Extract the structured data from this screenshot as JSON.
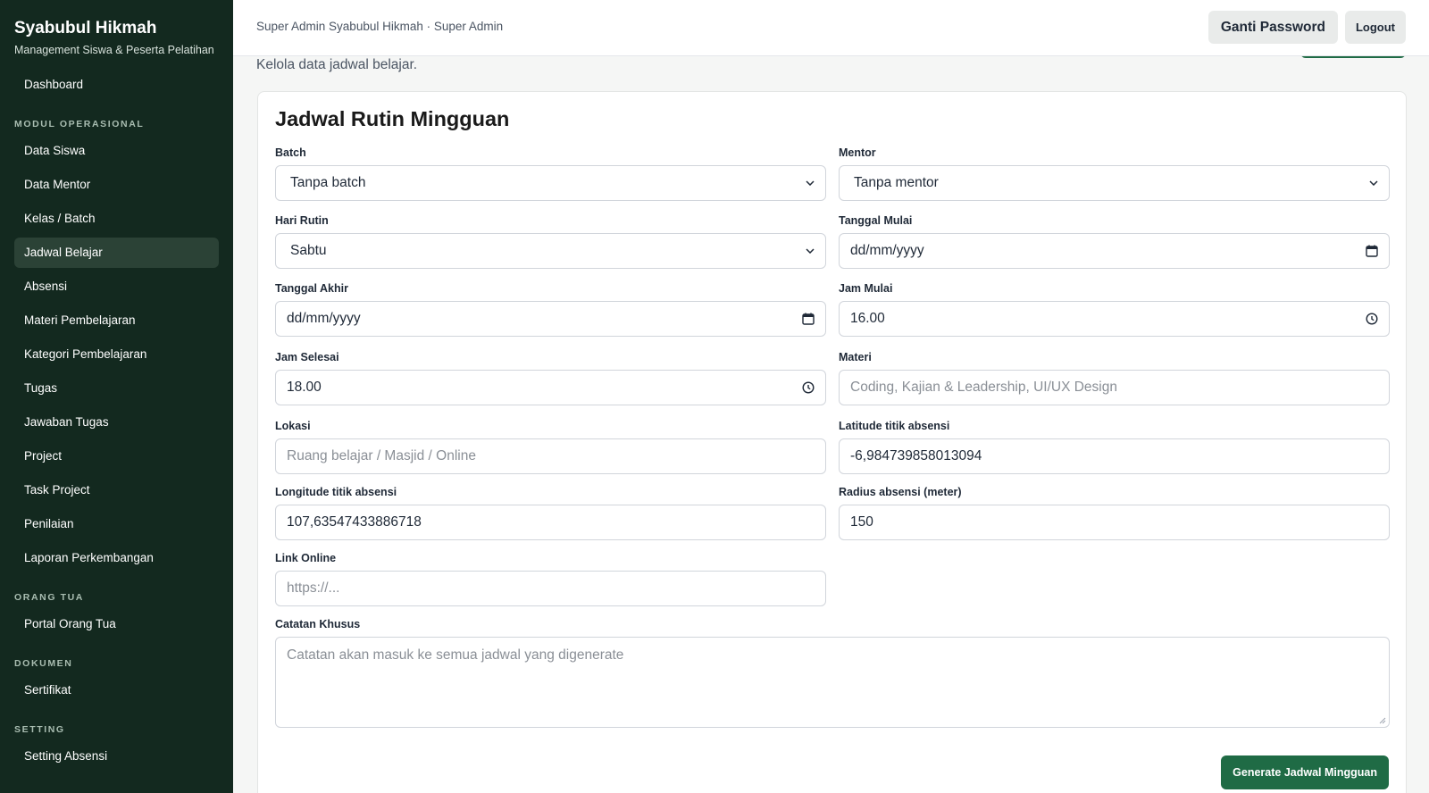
{
  "brand": {
    "title": "Syabubul Hikmah",
    "subtitle": "Management Siswa & Peserta Pelatihan"
  },
  "sidebar": {
    "top_items": [
      {
        "label": "Dashboard"
      }
    ],
    "sections": [
      {
        "title": "MODUL OPERASIONAL",
        "items": [
          {
            "label": "Data Siswa"
          },
          {
            "label": "Data Mentor"
          },
          {
            "label": "Kelas / Batch"
          },
          {
            "label": "Jadwal Belajar",
            "active": true
          },
          {
            "label": "Absensi"
          },
          {
            "label": "Materi Pembelajaran"
          },
          {
            "label": "Kategori Pembelajaran"
          },
          {
            "label": "Tugas"
          },
          {
            "label": "Jawaban Tugas"
          },
          {
            "label": "Project"
          },
          {
            "label": "Task Project"
          },
          {
            "label": "Penilaian"
          },
          {
            "label": "Laporan Perkembangan"
          }
        ]
      },
      {
        "title": "ORANG TUA",
        "items": [
          {
            "label": "Portal Orang Tua"
          }
        ]
      },
      {
        "title": "DOKUMEN",
        "items": [
          {
            "label": "Sertifikat"
          }
        ]
      },
      {
        "title": "SETTING",
        "items": [
          {
            "label": "Setting Absensi"
          }
        ]
      }
    ]
  },
  "topbar": {
    "user_text": "Super Admin Syabubul Hikmah · Super Admin",
    "change_password_label": "Ganti Password",
    "logout_label": "Logout"
  },
  "page": {
    "description": "Kelola data jadwal belajar."
  },
  "form": {
    "title": "Jadwal Rutin Mingguan",
    "batch": {
      "label": "Batch",
      "value": "Tanpa batch"
    },
    "mentor": {
      "label": "Mentor",
      "value": "Tanpa mentor"
    },
    "hari_rutin": {
      "label": "Hari Rutin",
      "value": "Sabtu"
    },
    "tanggal_mulai": {
      "label": "Tanggal Mulai",
      "value": "dd/mm/yyyy"
    },
    "tanggal_akhir": {
      "label": "Tanggal Akhir",
      "value": "dd/mm/yyyy"
    },
    "jam_mulai": {
      "label": "Jam Mulai",
      "value": "16.00"
    },
    "jam_selesai": {
      "label": "Jam Selesai",
      "value": "18.00"
    },
    "materi": {
      "label": "Materi",
      "placeholder": "Coding, Kajian & Leadership, UI/UX Design"
    },
    "lokasi": {
      "label": "Lokasi",
      "placeholder": "Ruang belajar / Masjid / Online"
    },
    "latitude": {
      "label": "Latitude titik absensi",
      "value": "-6,984739858013094"
    },
    "longitude": {
      "label": "Longitude titik absensi",
      "value": "107,63547433886718"
    },
    "radius": {
      "label": "Radius absensi (meter)",
      "value": "150"
    },
    "link_online": {
      "label": "Link Online",
      "placeholder": "https://..."
    },
    "catatan": {
      "label": "Catatan Khusus",
      "placeholder": "Catatan akan masuk ke semua jadwal yang digenerate"
    },
    "submit_label": "Generate Jadwal Mingguan"
  },
  "icons": {
    "select_arrow": "chevron-down-icon",
    "date": "calendar-icon",
    "time": "clock-icon"
  },
  "colors": {
    "sidebar_bg": "#13291f",
    "sidebar_active": "#2b4236",
    "primary_button": "#1f6b45"
  }
}
